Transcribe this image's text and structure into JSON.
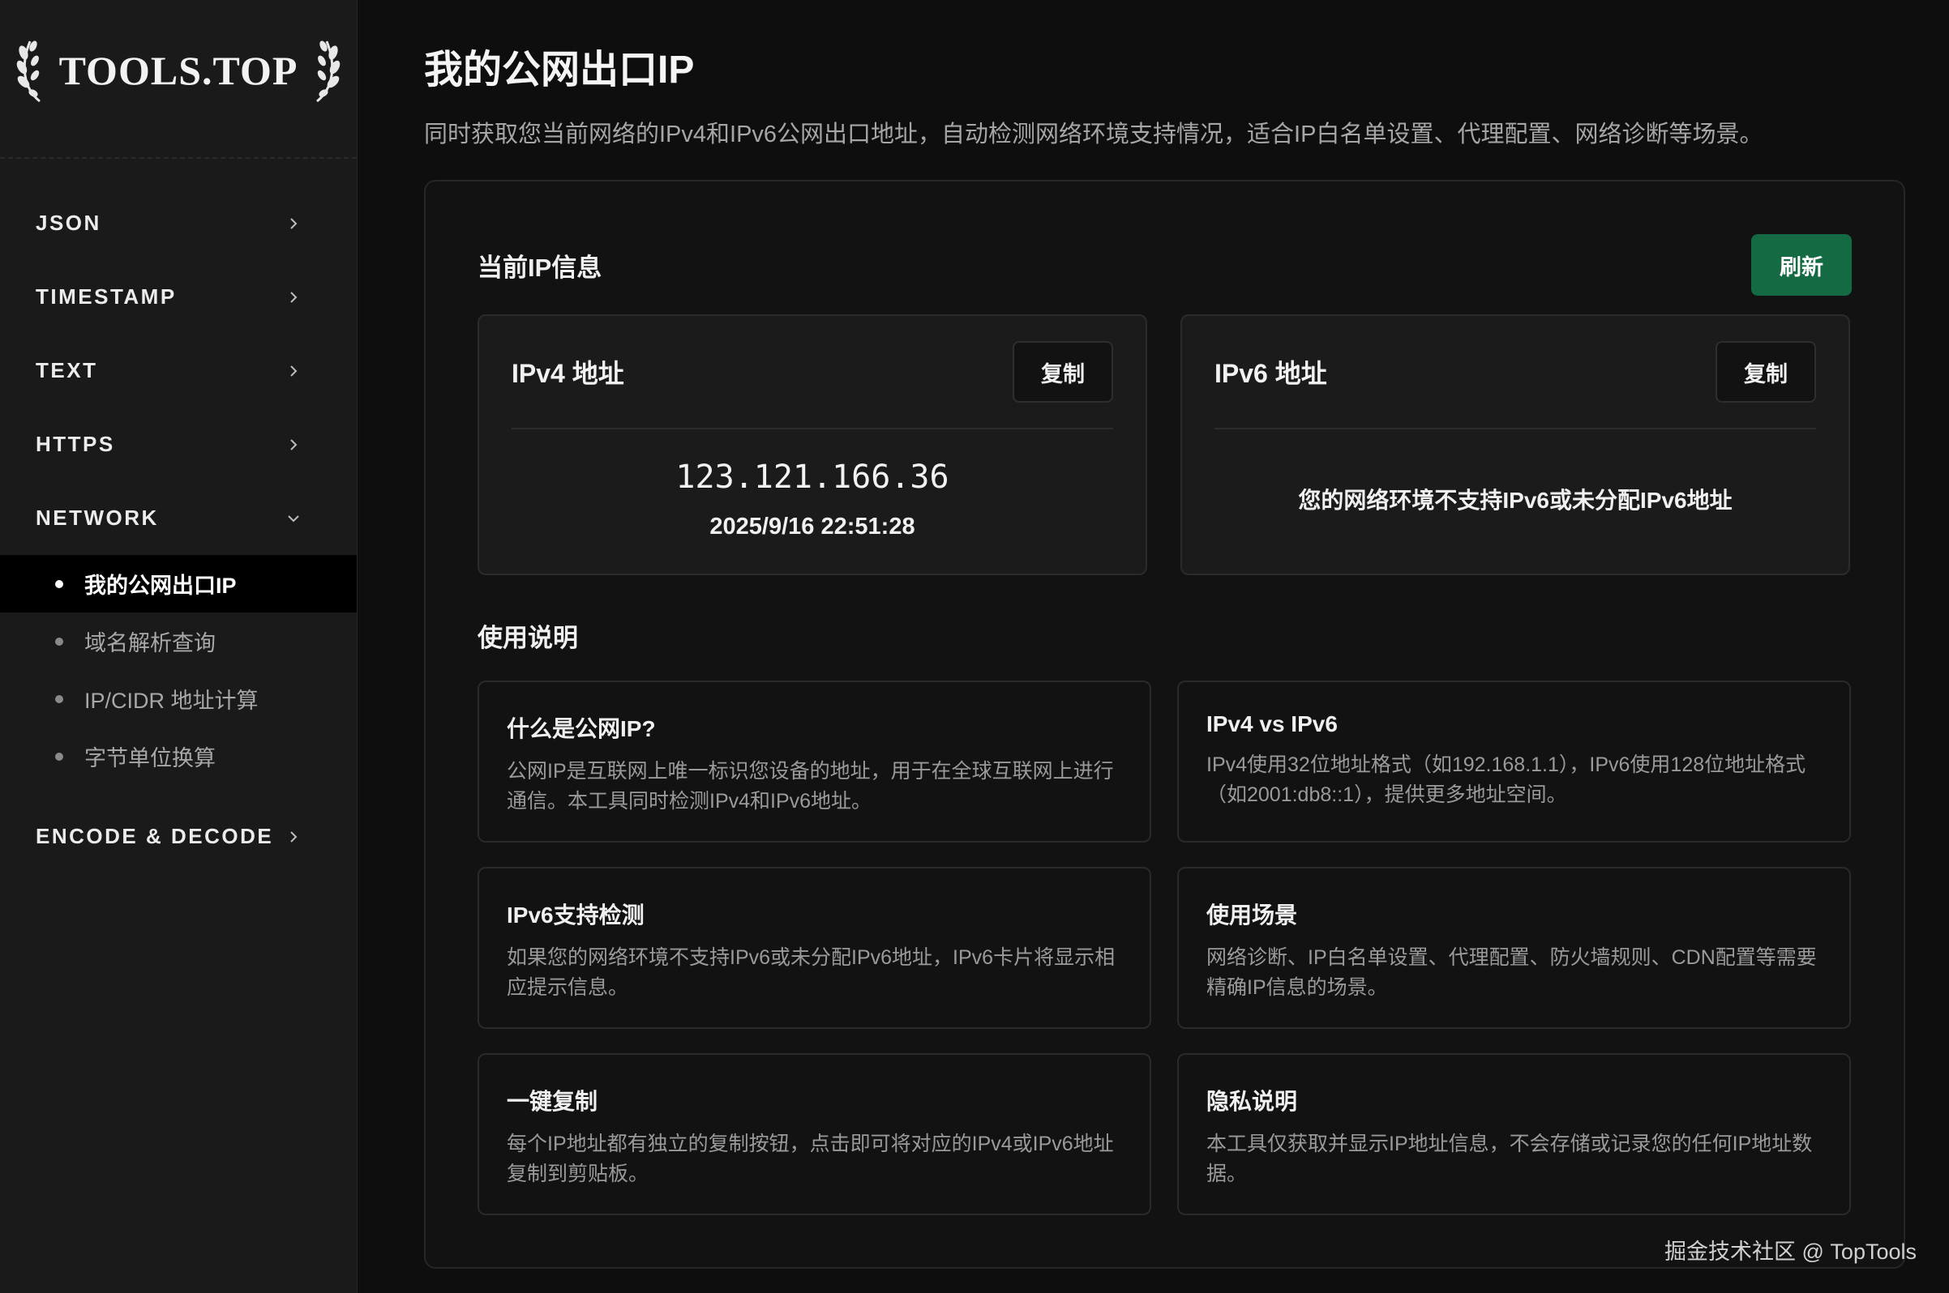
{
  "app": {
    "logo_text": "TOOLS.TOP"
  },
  "sidebar": {
    "items": [
      {
        "label": "JSON"
      },
      {
        "label": "TIMESTAMP"
      },
      {
        "label": "TEXT"
      },
      {
        "label": "HTTPS"
      },
      {
        "label": "NETWORK"
      },
      {
        "label": "ENCODE & DECODE"
      }
    ],
    "network_sub": [
      {
        "label": "我的公网出口IP",
        "active": true
      },
      {
        "label": "域名解析查询"
      },
      {
        "label": "IP/CIDR 地址计算"
      },
      {
        "label": "字节单位换算"
      }
    ]
  },
  "page": {
    "title": "我的公网出口IP",
    "description": "同时获取您当前网络的IPv4和IPv6公网出口地址，自动检测网络环境支持情况，适合IP白名单设置、代理配置、网络诊断等场景。"
  },
  "current": {
    "section_title": "当前IP信息",
    "refresh_label": "刷新",
    "ipv4": {
      "title": "IPv4 地址",
      "copy_label": "复制",
      "address": "123.121.166.36",
      "time": "2025/9/16 22:51:28"
    },
    "ipv6": {
      "title": "IPv6 地址",
      "copy_label": "复制",
      "message": "您的网络环境不支持IPv6或未分配IPv6地址"
    }
  },
  "usage": {
    "section_title": "使用说明",
    "cards": [
      {
        "title": "什么是公网IP?",
        "text": "公网IP是互联网上唯一标识您设备的地址，用于在全球互联网上进行通信。本工具同时检测IPv4和IPv6地址。"
      },
      {
        "title": "IPv4 vs IPv6",
        "text": "IPv4使用32位地址格式（如192.168.1.1），IPv6使用128位地址格式（如2001:db8::1），提供更多地址空间。"
      },
      {
        "title": "IPv6支持检测",
        "text": "如果您的网络环境不支持IPv6或未分配IPv6地址，IPv6卡片将显示相应提示信息。"
      },
      {
        "title": "使用场景",
        "text": "网络诊断、IP白名单设置、代理配置、防火墙规则、CDN配置等需要精确IP信息的场景。"
      },
      {
        "title": "一键复制",
        "text": "每个IP地址都有独立的复制按钮，点击即可将对应的IPv4或IPv6地址复制到剪贴板。"
      },
      {
        "title": "隐私说明",
        "text": "本工具仅获取并显示IP地址信息，不会存储或记录您的任何IP地址数据。"
      }
    ]
  },
  "watermark": "掘金技术社区 @ TopTools",
  "colors": {
    "accent": "#136a43",
    "background": "#0e0e0e",
    "sidebar": "#1a1a1a"
  }
}
